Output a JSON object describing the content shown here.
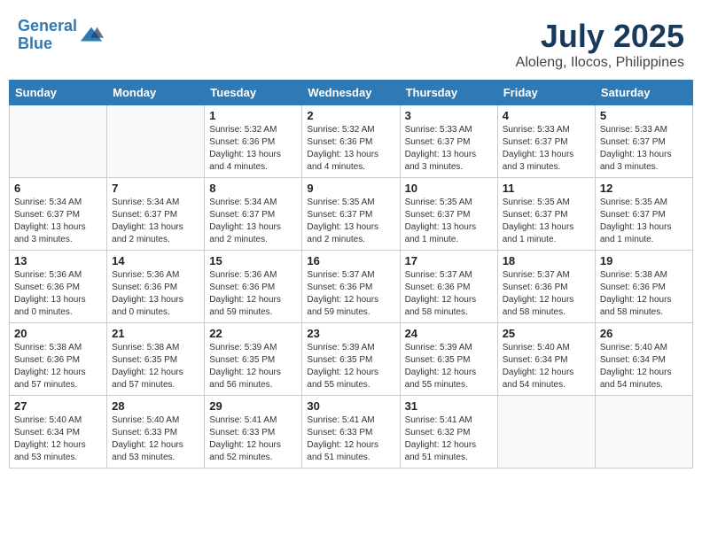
{
  "header": {
    "logo_line1": "General",
    "logo_line2": "Blue",
    "month_year": "July 2025",
    "location": "Aloleng, Ilocos, Philippines"
  },
  "weekdays": [
    "Sunday",
    "Monday",
    "Tuesday",
    "Wednesday",
    "Thursday",
    "Friday",
    "Saturday"
  ],
  "weeks": [
    [
      {
        "day": "",
        "info": ""
      },
      {
        "day": "",
        "info": ""
      },
      {
        "day": "1",
        "info": "Sunrise: 5:32 AM\nSunset: 6:36 PM\nDaylight: 13 hours\nand 4 minutes."
      },
      {
        "day": "2",
        "info": "Sunrise: 5:32 AM\nSunset: 6:36 PM\nDaylight: 13 hours\nand 4 minutes."
      },
      {
        "day": "3",
        "info": "Sunrise: 5:33 AM\nSunset: 6:37 PM\nDaylight: 13 hours\nand 3 minutes."
      },
      {
        "day": "4",
        "info": "Sunrise: 5:33 AM\nSunset: 6:37 PM\nDaylight: 13 hours\nand 3 minutes."
      },
      {
        "day": "5",
        "info": "Sunrise: 5:33 AM\nSunset: 6:37 PM\nDaylight: 13 hours\nand 3 minutes."
      }
    ],
    [
      {
        "day": "6",
        "info": "Sunrise: 5:34 AM\nSunset: 6:37 PM\nDaylight: 13 hours\nand 3 minutes."
      },
      {
        "day": "7",
        "info": "Sunrise: 5:34 AM\nSunset: 6:37 PM\nDaylight: 13 hours\nand 2 minutes."
      },
      {
        "day": "8",
        "info": "Sunrise: 5:34 AM\nSunset: 6:37 PM\nDaylight: 13 hours\nand 2 minutes."
      },
      {
        "day": "9",
        "info": "Sunrise: 5:35 AM\nSunset: 6:37 PM\nDaylight: 13 hours\nand 2 minutes."
      },
      {
        "day": "10",
        "info": "Sunrise: 5:35 AM\nSunset: 6:37 PM\nDaylight: 13 hours\nand 1 minute."
      },
      {
        "day": "11",
        "info": "Sunrise: 5:35 AM\nSunset: 6:37 PM\nDaylight: 13 hours\nand 1 minute."
      },
      {
        "day": "12",
        "info": "Sunrise: 5:35 AM\nSunset: 6:37 PM\nDaylight: 13 hours\nand 1 minute."
      }
    ],
    [
      {
        "day": "13",
        "info": "Sunrise: 5:36 AM\nSunset: 6:36 PM\nDaylight: 13 hours\nand 0 minutes."
      },
      {
        "day": "14",
        "info": "Sunrise: 5:36 AM\nSunset: 6:36 PM\nDaylight: 13 hours\nand 0 minutes."
      },
      {
        "day": "15",
        "info": "Sunrise: 5:36 AM\nSunset: 6:36 PM\nDaylight: 12 hours\nand 59 minutes."
      },
      {
        "day": "16",
        "info": "Sunrise: 5:37 AM\nSunset: 6:36 PM\nDaylight: 12 hours\nand 59 minutes."
      },
      {
        "day": "17",
        "info": "Sunrise: 5:37 AM\nSunset: 6:36 PM\nDaylight: 12 hours\nand 58 minutes."
      },
      {
        "day": "18",
        "info": "Sunrise: 5:37 AM\nSunset: 6:36 PM\nDaylight: 12 hours\nand 58 minutes."
      },
      {
        "day": "19",
        "info": "Sunrise: 5:38 AM\nSunset: 6:36 PM\nDaylight: 12 hours\nand 58 minutes."
      }
    ],
    [
      {
        "day": "20",
        "info": "Sunrise: 5:38 AM\nSunset: 6:36 PM\nDaylight: 12 hours\nand 57 minutes."
      },
      {
        "day": "21",
        "info": "Sunrise: 5:38 AM\nSunset: 6:35 PM\nDaylight: 12 hours\nand 57 minutes."
      },
      {
        "day": "22",
        "info": "Sunrise: 5:39 AM\nSunset: 6:35 PM\nDaylight: 12 hours\nand 56 minutes."
      },
      {
        "day": "23",
        "info": "Sunrise: 5:39 AM\nSunset: 6:35 PM\nDaylight: 12 hours\nand 55 minutes."
      },
      {
        "day": "24",
        "info": "Sunrise: 5:39 AM\nSunset: 6:35 PM\nDaylight: 12 hours\nand 55 minutes."
      },
      {
        "day": "25",
        "info": "Sunrise: 5:40 AM\nSunset: 6:34 PM\nDaylight: 12 hours\nand 54 minutes."
      },
      {
        "day": "26",
        "info": "Sunrise: 5:40 AM\nSunset: 6:34 PM\nDaylight: 12 hours\nand 54 minutes."
      }
    ],
    [
      {
        "day": "27",
        "info": "Sunrise: 5:40 AM\nSunset: 6:34 PM\nDaylight: 12 hours\nand 53 minutes."
      },
      {
        "day": "28",
        "info": "Sunrise: 5:40 AM\nSunset: 6:33 PM\nDaylight: 12 hours\nand 53 minutes."
      },
      {
        "day": "29",
        "info": "Sunrise: 5:41 AM\nSunset: 6:33 PM\nDaylight: 12 hours\nand 52 minutes."
      },
      {
        "day": "30",
        "info": "Sunrise: 5:41 AM\nSunset: 6:33 PM\nDaylight: 12 hours\nand 51 minutes."
      },
      {
        "day": "31",
        "info": "Sunrise: 5:41 AM\nSunset: 6:32 PM\nDaylight: 12 hours\nand 51 minutes."
      },
      {
        "day": "",
        "info": ""
      },
      {
        "day": "",
        "info": ""
      }
    ]
  ]
}
